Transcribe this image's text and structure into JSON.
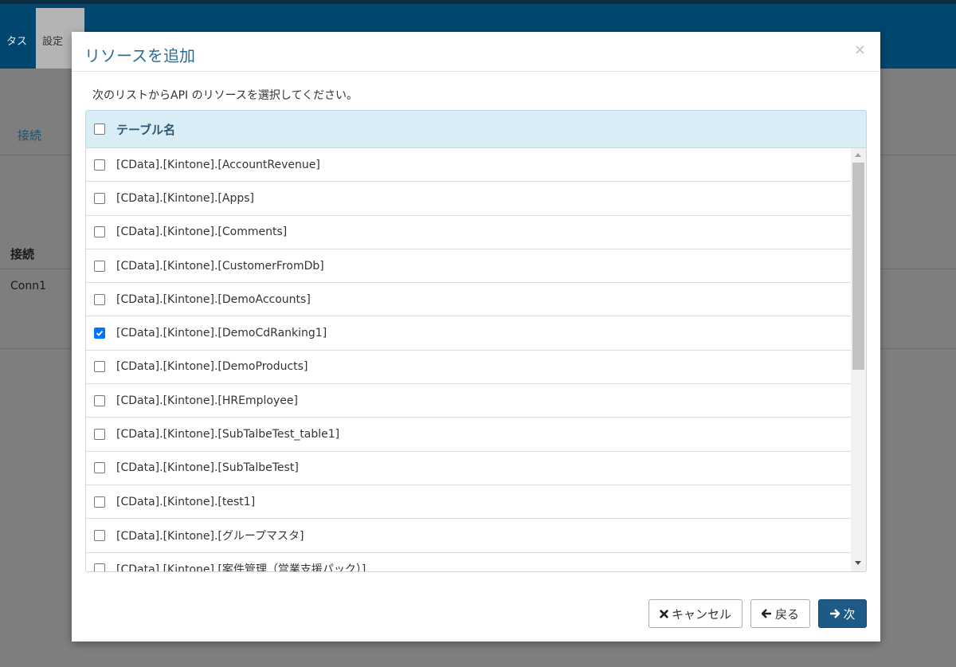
{
  "background": {
    "nav_status": "タス",
    "nav_settings": "設定",
    "tab_connection": "接続",
    "column_connection": "接続",
    "cell_conn": "Conn1"
  },
  "modal": {
    "title": "リソースを追加",
    "close": "×",
    "instruction": "次のリストからAPI のリソースを選択してください。",
    "table_header": "テーブル名",
    "rows": [
      {
        "label": "[CData].[Kintone].[AccountRevenue]",
        "checked": false
      },
      {
        "label": "[CData].[Kintone].[Apps]",
        "checked": false
      },
      {
        "label": "[CData].[Kintone].[Comments]",
        "checked": false
      },
      {
        "label": "[CData].[Kintone].[CustomerFromDb]",
        "checked": false
      },
      {
        "label": "[CData].[Kintone].[DemoAccounts]",
        "checked": false
      },
      {
        "label": "[CData].[Kintone].[DemoCdRanking1]",
        "checked": true
      },
      {
        "label": "[CData].[Kintone].[DemoProducts]",
        "checked": false
      },
      {
        "label": "[CData].[Kintone].[HREmployee]",
        "checked": false
      },
      {
        "label": "[CData].[Kintone].[SubTalbeTest_table1]",
        "checked": false
      },
      {
        "label": "[CData].[Kintone].[SubTalbeTest]",
        "checked": false
      },
      {
        "label": "[CData].[Kintone].[test1]",
        "checked": false
      },
      {
        "label": "[CData].[Kintone].[グループマスタ]",
        "checked": false
      },
      {
        "label": "[CData].[Kintone].[案件管理（営業支援パック）]",
        "checked": false
      }
    ],
    "buttons": {
      "cancel": "キャンセル",
      "back": "戻る",
      "next": "次"
    }
  },
  "colors": {
    "topbar": "#00466e",
    "title": "#2b6d99",
    "table_header_bg": "#d9edf7",
    "primary_button": "#1d5b86",
    "checkbox_checked": "#0075ff"
  }
}
